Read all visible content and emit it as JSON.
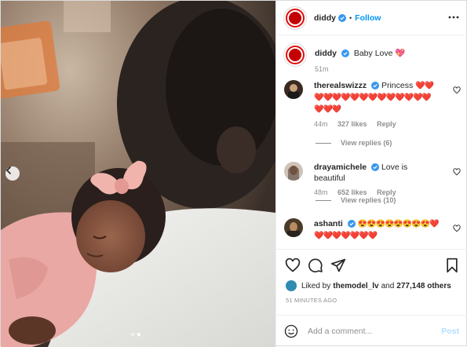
{
  "post": {
    "photo_alt": "",
    "carousel": {
      "total": 2,
      "current": 2
    }
  },
  "header": {
    "username": "diddy",
    "separator": "•",
    "follow_label": "Follow"
  },
  "caption": {
    "username": "diddy",
    "text": "Baby Love",
    "emoji": "💖",
    "time": "51m"
  },
  "comments": [
    {
      "username": "therealswizzz",
      "text": "Princess",
      "emoji": "❤️❤️❤️❤️❤️❤️❤️❤️❤️❤️❤️❤️❤️❤️❤️❤️❤️❤️",
      "time": "44m",
      "likes": "327 likes",
      "reply": "Reply",
      "view_replies": "View replies (6)"
    },
    {
      "username": "drayamichele",
      "text": "Love is beautiful",
      "emoji": "",
      "time": "48m",
      "likes": "652 likes",
      "reply": "Reply",
      "view_replies": "View replies (10)"
    },
    {
      "username": "ashanti",
      "text": "",
      "emoji": "😍😍😍😍😍😍😍😍❤️❤️❤️❤️❤️❤️❤️❤️",
      "time": "",
      "likes": "",
      "reply": "",
      "view_replies": ""
    }
  ],
  "engagement": {
    "liked_by_prefix": "Liked by",
    "liked_by_user": "themodel_lv",
    "and": "and",
    "others_count": "277,148 others",
    "time_ago": "51 MINUTES AGO"
  },
  "add_comment": {
    "placeholder": "Add a comment...",
    "post_label": "Post"
  },
  "colors": {
    "accent": "#0095f6",
    "heart": "#ed4956",
    "muted": "#8e8e8e",
    "post_disabled": "#b2dffc"
  }
}
